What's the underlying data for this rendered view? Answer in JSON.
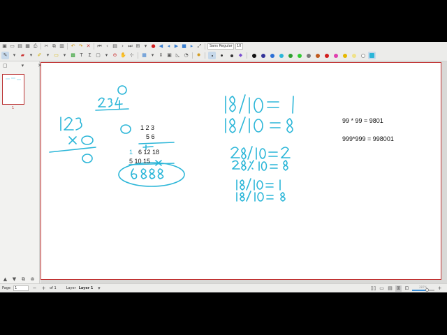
{
  "toolbar": {
    "font_name": "Sans Regular",
    "font_size": "10",
    "colors": [
      "#111111",
      "#333399",
      "#2b6fd6",
      "#2bb6d8",
      "#2e9e2e",
      "#33cc33",
      "#7a7a7a",
      "#c05a1e",
      "#d21e1e",
      "#e040b0",
      "#e6b800",
      "#f0e28a",
      "#ffffff",
      "#2bb6d8"
    ],
    "active_color": "#2bb6d8"
  },
  "sidebar": {
    "thumb_label": "1"
  },
  "page": {
    "typed": {
      "eq1": "99 * 99 = 9801",
      "eq2": "999*999 = 998001",
      "n123": "1 2 3",
      "n56": "5 6",
      "n612": "6 12 18",
      "n1": "1",
      "n5": "5 10 15"
    }
  },
  "statusbar": {
    "page_label": "Page",
    "page_value": "1",
    "of_label": "of 1",
    "layer_label": "Layer",
    "layer_value": "Layer 1",
    "zoom_label": "287%",
    "zoom_fraction": 0.7
  }
}
